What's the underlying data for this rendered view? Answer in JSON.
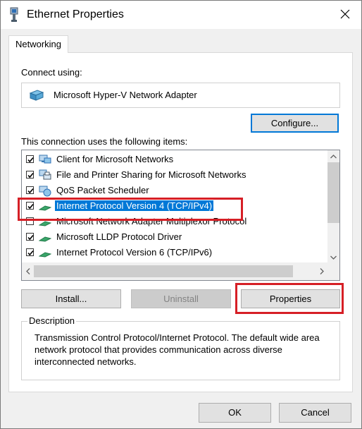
{
  "window": {
    "title": "Ethernet Properties"
  },
  "tabs": [
    {
      "label": "Networking"
    }
  ],
  "connect_using": {
    "label": "Connect using:",
    "adapter_name": "Microsoft Hyper-V Network Adapter"
  },
  "buttons": {
    "configure": "Configure...",
    "install": "Install...",
    "uninstall": "Uninstall",
    "properties": "Properties",
    "ok": "OK",
    "cancel": "Cancel"
  },
  "items_label": "This connection uses the following items:",
  "items": [
    {
      "label": "Client for Microsoft Networks",
      "checked": true,
      "icon": "client-network-icon"
    },
    {
      "label": "File and Printer Sharing for Microsoft Networks",
      "checked": true,
      "icon": "file-printer-sharing-icon"
    },
    {
      "label": "QoS Packet Scheduler",
      "checked": true,
      "icon": "qos-scheduler-icon"
    },
    {
      "label": "Internet Protocol Version 4 (TCP/IPv4)",
      "checked": true,
      "selected": true,
      "icon": "protocol-icon"
    },
    {
      "label": "Microsoft Network Adapter Multiplexor Protocol",
      "checked": false,
      "icon": "protocol-icon"
    },
    {
      "label": "Microsoft LLDP Protocol Driver",
      "checked": true,
      "icon": "protocol-icon"
    },
    {
      "label": "Internet Protocol Version 6 (TCP/IPv6)",
      "checked": true,
      "icon": "protocol-icon"
    }
  ],
  "description": {
    "legend": "Description",
    "text": "Transmission Control Protocol/Internet Protocol. The default wide area network protocol that provides communication across diverse interconnected networks."
  },
  "colors": {
    "highlight_box": "#d61f26",
    "selection": "#0078d7",
    "default_button_border": "#0078d7"
  }
}
